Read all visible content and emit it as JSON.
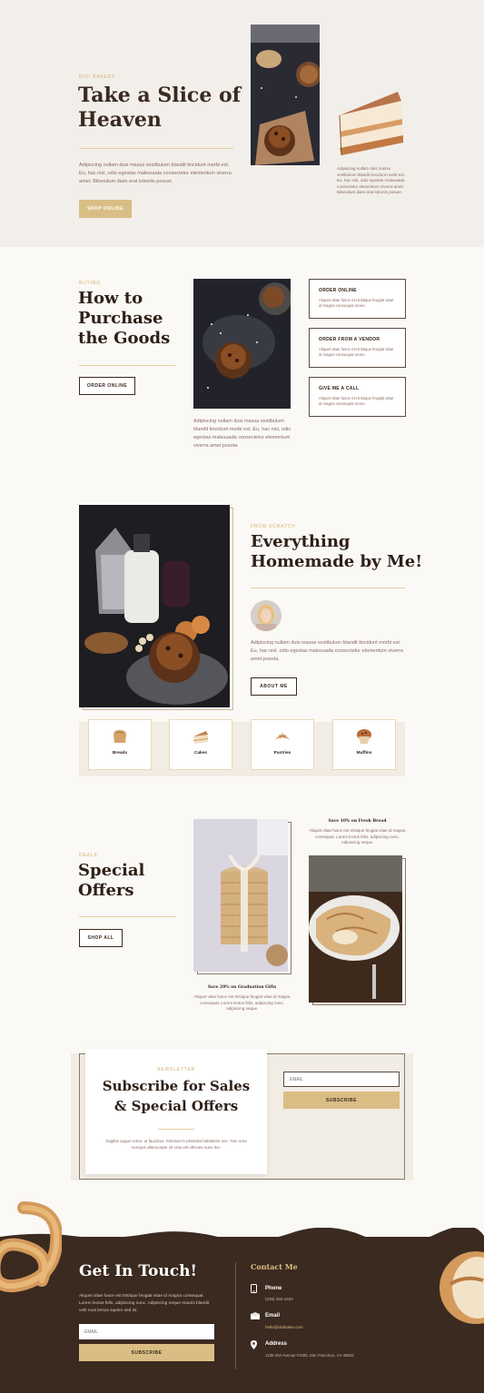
{
  "colors": {
    "gold": "#d9bd84",
    "dark_brown": "#3b2a20",
    "text": "#8a6a62"
  },
  "hero": {
    "eyebrow": "DIVI BAKERY",
    "title_line1": "Take a Slice of",
    "title_line2": "Heaven",
    "text": "Adipiscing nullam duis massa vestibulum blandit tincidunt morbi est. Eu, hac nisl, odio egestas malesuada consectetur elementum viverra amet. Bibendum diam erat lobortis posuer.",
    "button": "SHOP ONLINE",
    "side_text": "Adipiscing nullam duis massa vestibulum blandit tincidunt morbi est. Eu, hac nisl, odio egestas malesuada consectetur elementum viverra amet. Bibendum diam erat lobortis posuer."
  },
  "purchase": {
    "eyebrow": "BUYING",
    "title_line1": "How to",
    "title_line2": "Purchase",
    "title_line3": "the Goods",
    "button": "ORDER ONLINE",
    "text": "Adipiscing nullam duis massa vestibulum blandit tincidunt morbi est. Eu, hac nisl, odio egestas malesuada consectetur elementum viverra amet posota.",
    "cards": [
      {
        "title": "ORDER ONLINE",
        "text": "Aliquet vitae fusce est tristique feugiat vitae id magna consequat omne."
      },
      {
        "title": "ORDER FROM A VENDOR",
        "text": "Aliquet vitae fusce est tristique feugiat vitae id magna consequat omne."
      },
      {
        "title": "GIVE ME A CALL",
        "text": "Aliquet vitae fusce est tristique feugiat vitae id magna consequat omne."
      }
    ]
  },
  "homemade": {
    "eyebrow": "FROM SCRATCH",
    "title_line1": "Everything",
    "title_line2": "Homemade by Me!",
    "text": "Adipiscing nullam duis massa vestibulum blandit tincidunt morbi est. Eu, hac nisl, odio egestas malesuada consectetur elementum viverra amet posota.",
    "button": "ABOUT ME",
    "categories": [
      {
        "label": "Breads",
        "icon": "bread-icon"
      },
      {
        "label": "Cakes",
        "icon": "cake-icon"
      },
      {
        "label": "Pastries",
        "icon": "croissant-icon"
      },
      {
        "label": "Muffins",
        "icon": "muffin-icon"
      }
    ]
  },
  "offers": {
    "eyebrow": "DEALS",
    "title_line1": "Special",
    "title_line2": "Offers",
    "button": "SHOP ALL",
    "offer1": {
      "title": "Save 20% on Graduation Gifts",
      "text": "Aliquet vitae fusce est tristique feugiat vitae id magna consequat. Lorem lectus felis, adipiscing nunc. Adipiscing neque."
    },
    "offer2": {
      "title": "Save 10% on Fresh Bread",
      "text": "Aliquet vitae fusce est tristique feugiat vitae id magna consequat. Lorem lectus felis, adipiscing nunc. Adipiscing neque."
    }
  },
  "newsletter": {
    "eyebrow": "NEWSLETTER",
    "title_line1": "Subscribe for Sales",
    "title_line2": "& Special Offers",
    "text": "Sagittis augue tortor, ut faucibus. Pulvinar in pharetra habitasse nec. Non urna suscipit ullamcorper sit cras vel ultricies nunc leo.",
    "email_placeholder": "EMAIL",
    "button": "SUBSCRIBE"
  },
  "footer": {
    "title": "Get In Touch!",
    "text": "Aliquet vitae fusce est tristique feugiat vitae id magna consequat. Lorem lectus felis, adipiscing nunc. Adipiscing neque mauris blandit velit mus lectus sapien sed sit.",
    "email_placeholder": "EMAIL",
    "button": "SUBSCRIBE",
    "contact_heading": "Contact Me",
    "phone_label": "Phone",
    "phone_value": "(235) 462-4434",
    "email_label": "Email",
    "email_value": "hello@divibaker.com",
    "address_label": "Address",
    "address_value": "1235 Divi Avenue #1000, San Francisco, CA 49623"
  }
}
